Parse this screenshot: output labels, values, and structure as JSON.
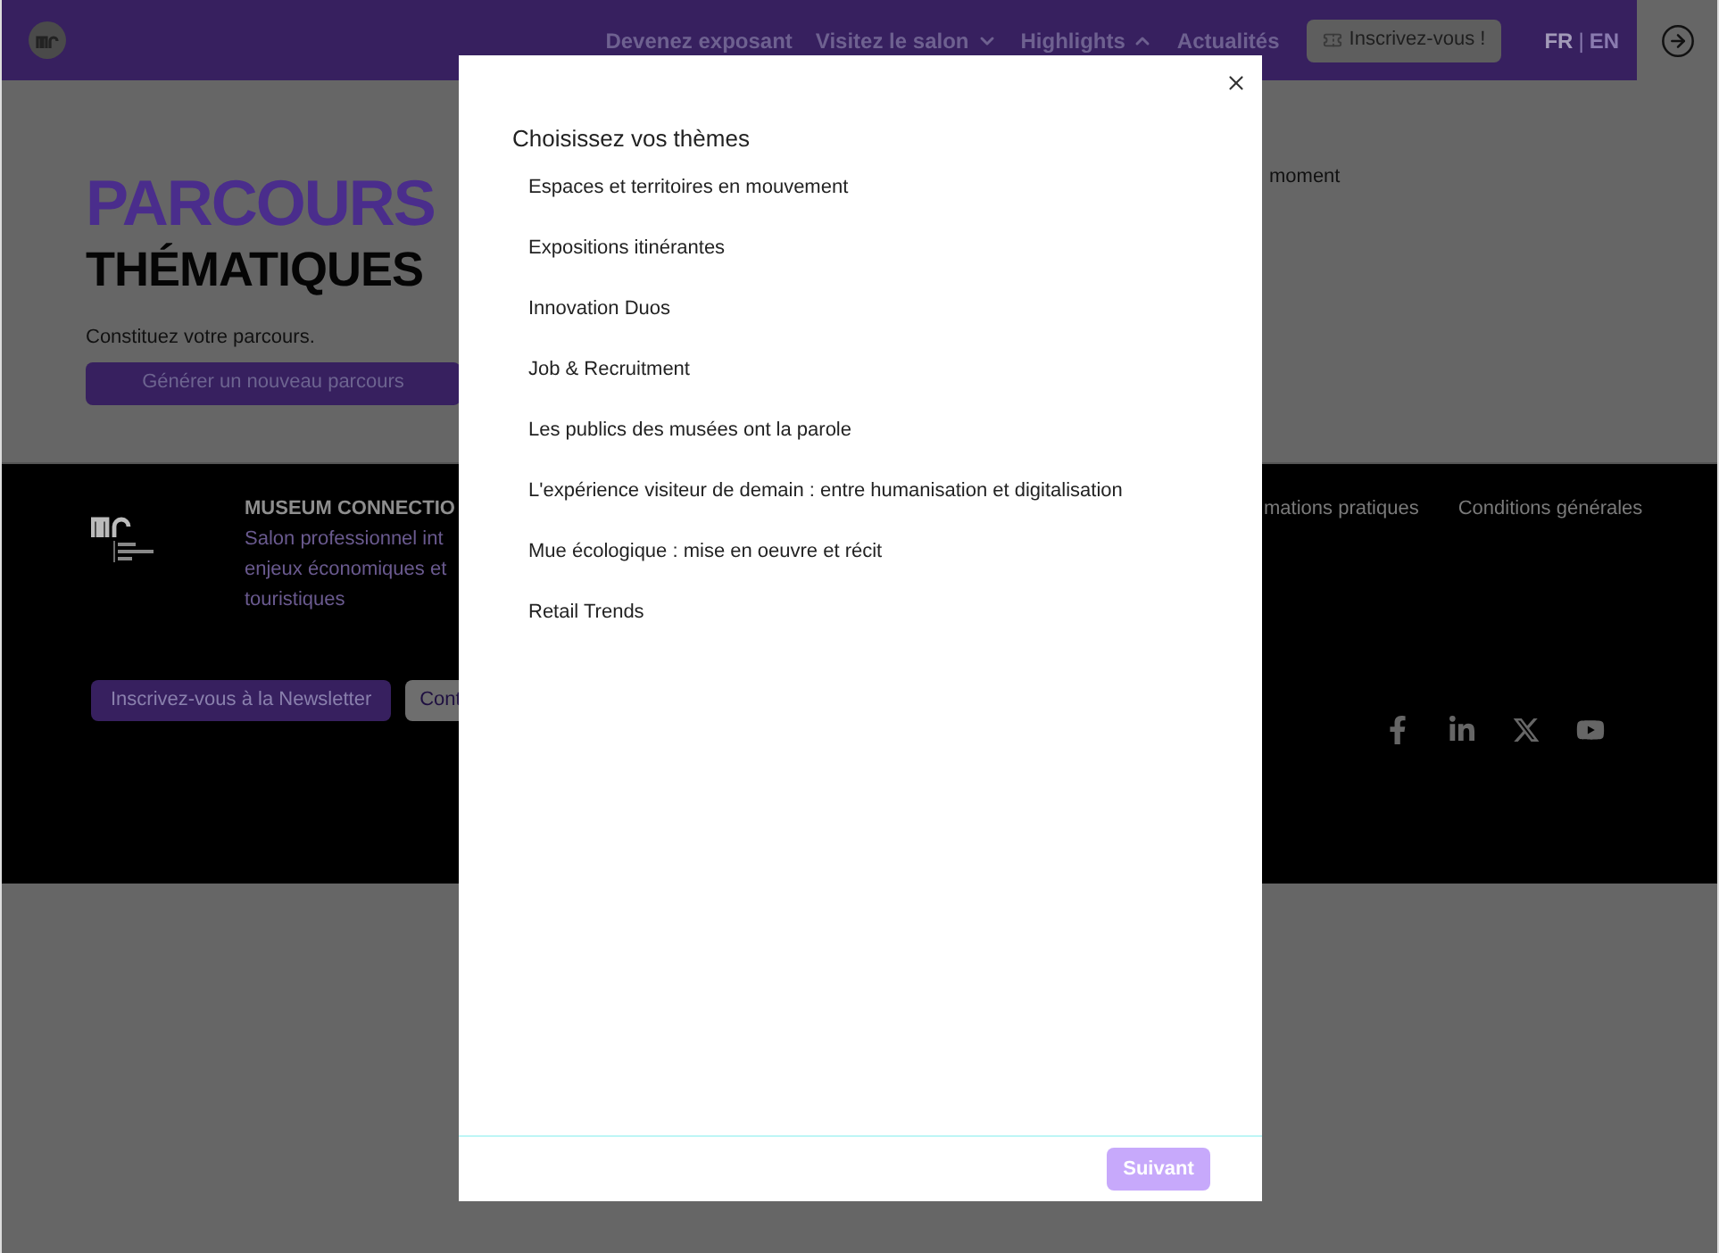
{
  "header": {
    "nav": [
      {
        "label": "Devenez exposant",
        "kind": "link"
      },
      {
        "label": "Visitez le salon",
        "kind": "dropdown",
        "expanded": false
      },
      {
        "label": "Highlights",
        "kind": "dropdown",
        "expanded": true
      },
      {
        "label": "Actualités",
        "kind": "link"
      }
    ],
    "cta": "Inscrivez-vous !",
    "languages": [
      {
        "label": "FR",
        "selected": true
      },
      {
        "label": "EN",
        "selected": false
      }
    ],
    "separator": "|"
  },
  "hero": {
    "title": "PARCOURS",
    "subtitle": "THÉMATIQUES",
    "text": "Constituez votre parcours.",
    "button": "Générer un nouveau parcours",
    "side_text": "moment"
  },
  "footer": {
    "brand": "MUSEUM CONNECTIO",
    "description": [
      "Salon professionnel int",
      "enjeux économiques et",
      "touristiques"
    ],
    "links": [
      "mations pratiques",
      "Conditions générales"
    ],
    "buttons": [
      {
        "label": "Inscrivez-vous à la Newsletter",
        "kind": "primary"
      },
      {
        "label": "Cont",
        "kind": "secondary"
      }
    ],
    "social": [
      {
        "kind": "facebook"
      },
      {
        "kind": "linkedin"
      },
      {
        "kind": "x"
      },
      {
        "kind": "youtube"
      }
    ]
  },
  "modal": {
    "title": "Choisissez vos thèmes",
    "themes": [
      "Espaces et territoires en mouvement",
      "Expositions itinérantes",
      "Innovation Duos",
      "Job & Recruitment",
      "Les publics des musées ont la parole",
      "L'expérience visiteur de demain : entre humanisation et digitalisation",
      "Mue écologique : mise en oeuvre et récit",
      "Retail Trends"
    ],
    "next": {
      "label": "Suivant",
      "disabled": true
    }
  }
}
